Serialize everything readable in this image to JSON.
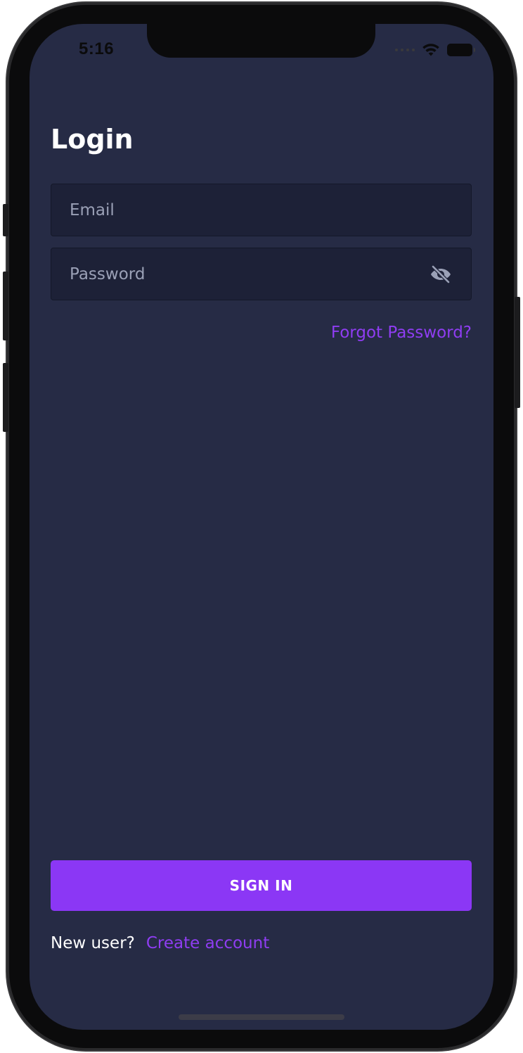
{
  "status_bar": {
    "time": "5:16"
  },
  "login": {
    "title": "Login",
    "email": {
      "placeholder": "Email",
      "value": ""
    },
    "password": {
      "placeholder": "Password",
      "value": ""
    },
    "forgot_password_label": "Forgot Password?",
    "sign_in_label": "SIGN IN",
    "new_user_text": "New user?",
    "create_account_label": "Create account"
  },
  "icons": {
    "password_visibility": "eye-off-icon",
    "wifi": "wifi-icon",
    "battery": "battery-icon",
    "signal": "signal-icon"
  },
  "colors": {
    "background": "#262b45",
    "field_background": "#1d2137",
    "accent": "#8b37f5",
    "link": "#8f3df2",
    "text_primary": "#ffffff",
    "placeholder": "#9aa0b6"
  }
}
